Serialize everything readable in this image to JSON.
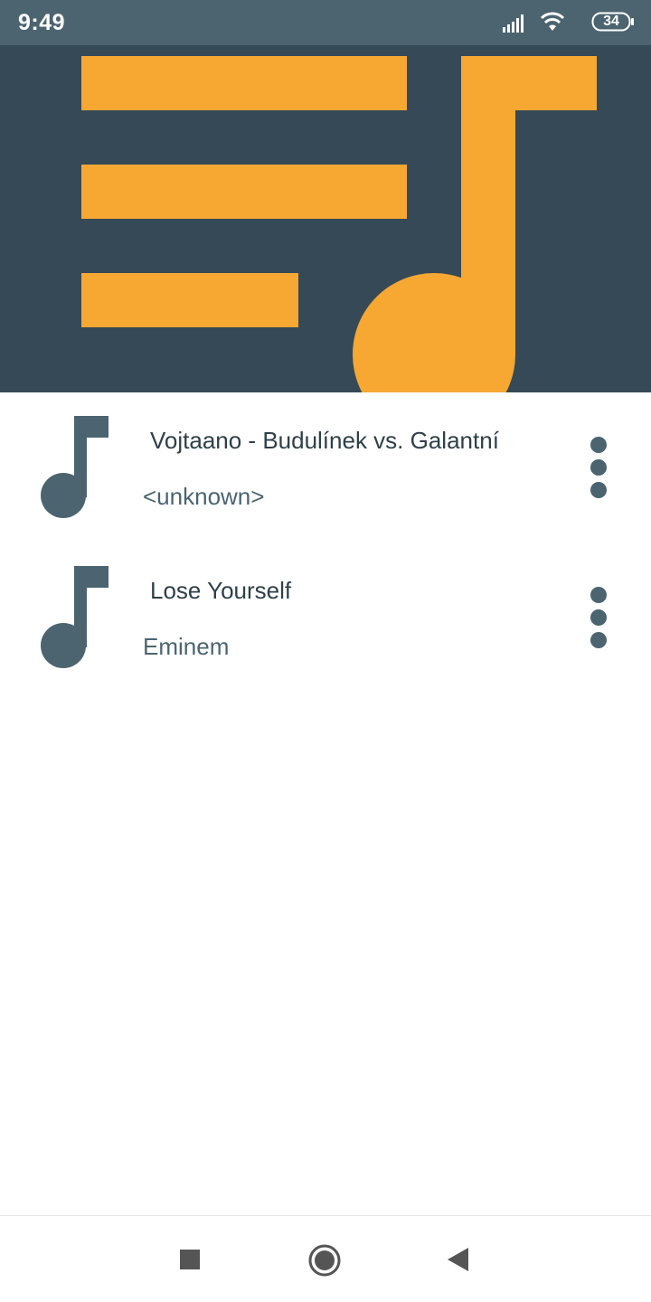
{
  "status_bar": {
    "time": "9:49",
    "battery": "34",
    "icons": [
      "signal-icon",
      "wifi-icon",
      "battery-icon"
    ]
  },
  "header": {
    "art": "playlist-music-icon",
    "colors": {
      "background": "#364956",
      "accent": "#f6a832"
    }
  },
  "tracks": [
    {
      "title": "Vojtaano - Budulínek vs. Galantní",
      "artist": "<unknown>",
      "icon": "music-note-icon",
      "menu_icon": "more-vertical-icon"
    },
    {
      "title": "Lose Yourself",
      "artist": "Eminem",
      "icon": "music-note-icon",
      "menu_icon": "more-vertical-icon"
    }
  ],
  "nav_bar": {
    "buttons": [
      "recents-square-icon",
      "home-circle-icon",
      "back-triangle-icon"
    ]
  },
  "colors": {
    "status_bar": "#4b6470",
    "icon": "#4b6470",
    "title_text": "#2f3f48"
  }
}
